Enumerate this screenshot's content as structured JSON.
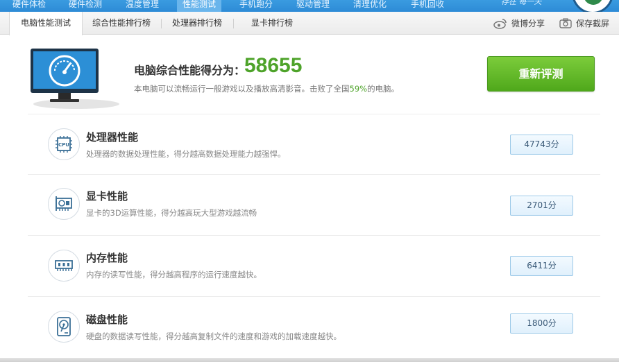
{
  "topnav": {
    "items": [
      "硬件体检",
      "硬件检测",
      "温度管理",
      "性能测试",
      "手机跑分",
      "驱动管理",
      "清理优化",
      "手机回收"
    ],
    "active_index": 3,
    "slogan": "存在 每一天"
  },
  "subtabs": {
    "items": [
      "电脑性能测试",
      "综合性能排行榜",
      "处理器排行榜",
      "显卡排行榜"
    ],
    "active_index": 0
  },
  "tools": {
    "weibo_share": "微博分享",
    "save_screenshot": "保存截屏"
  },
  "summary": {
    "title": "电脑综合性能得分为：",
    "score": "58655",
    "desc_prefix": "本电脑可以流畅运行一般游戏以及播放高清影音。击败了全国",
    "desc_percent": "59%",
    "desc_suffix": "的电脑。",
    "retest_label": "重新评测"
  },
  "rows": [
    {
      "icon": "cpu-icon",
      "title": "处理器性能",
      "desc": "处理器的数据处理性能，得分越高数据处理能力越强悍。",
      "score": "47743分"
    },
    {
      "icon": "graphics-card-icon",
      "title": "显卡性能",
      "desc": "显卡的3D运算性能，得分越高玩大型游戏越流畅",
      "score": "2701分"
    },
    {
      "icon": "memory-icon",
      "title": "内存性能",
      "desc": "内存的读写性能，得分越高程序的运行速度越快。",
      "score": "6411分"
    },
    {
      "icon": "hard-disk-icon",
      "title": "磁盘性能",
      "desc": "硬盘的数据读写性能，得分越高复制文件的速度和游戏的加载速度越快。",
      "score": "1800分"
    }
  ],
  "colors": {
    "accent_green": "#4ea32a",
    "nav_blue": "#2d8bd6",
    "score_box_border": "#9cc9e8"
  }
}
